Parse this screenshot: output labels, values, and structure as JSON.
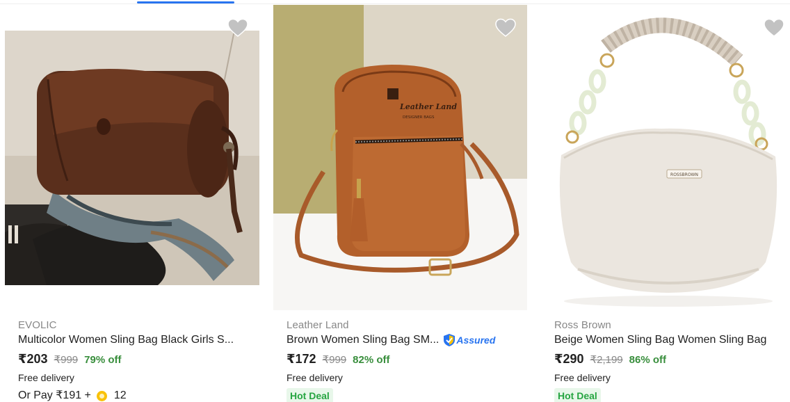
{
  "products": [
    {
      "brand": "EVOLIC",
      "title": "Multicolor Women Sling Bag Black Girls S...",
      "price": "₹203",
      "mrp": "₹999",
      "discount": "79% off",
      "delivery": "Free delivery",
      "or_pay": "Or Pay ₹191 +",
      "coins": "12",
      "image": "brown-barrel-sling-bag-photo"
    },
    {
      "brand": "Leather Land",
      "title": "Brown Women Sling Bag SM...",
      "assured_label": "Assured",
      "price": "₹172",
      "mrp": "₹999",
      "discount": "82% off",
      "delivery": "Free delivery",
      "badge": "Hot Deal",
      "image": "brown-leather-mobile-sling-bag-photo",
      "logo_text": "Leather Land",
      "logo_sub": "DESIGNER BAGS"
    },
    {
      "brand": "Ross Brown",
      "title": "Beige Women Sling Bag Women Sling Bag",
      "price": "₹290",
      "mrp": "₹2,199",
      "discount": "86% off",
      "delivery": "Free delivery",
      "badge": "Hot Deal",
      "image": "beige-chain-handle-bag-photo",
      "logo_text": "ROSSBROWN"
    }
  ],
  "colors": {
    "accent_blue": "#2874f0",
    "discount_green": "#388e3c",
    "hot_deal_bg": "#e8f7ea",
    "hot_deal_text": "#26a541",
    "heart_fill": "#c2c2c2",
    "muted_text": "#878787"
  }
}
